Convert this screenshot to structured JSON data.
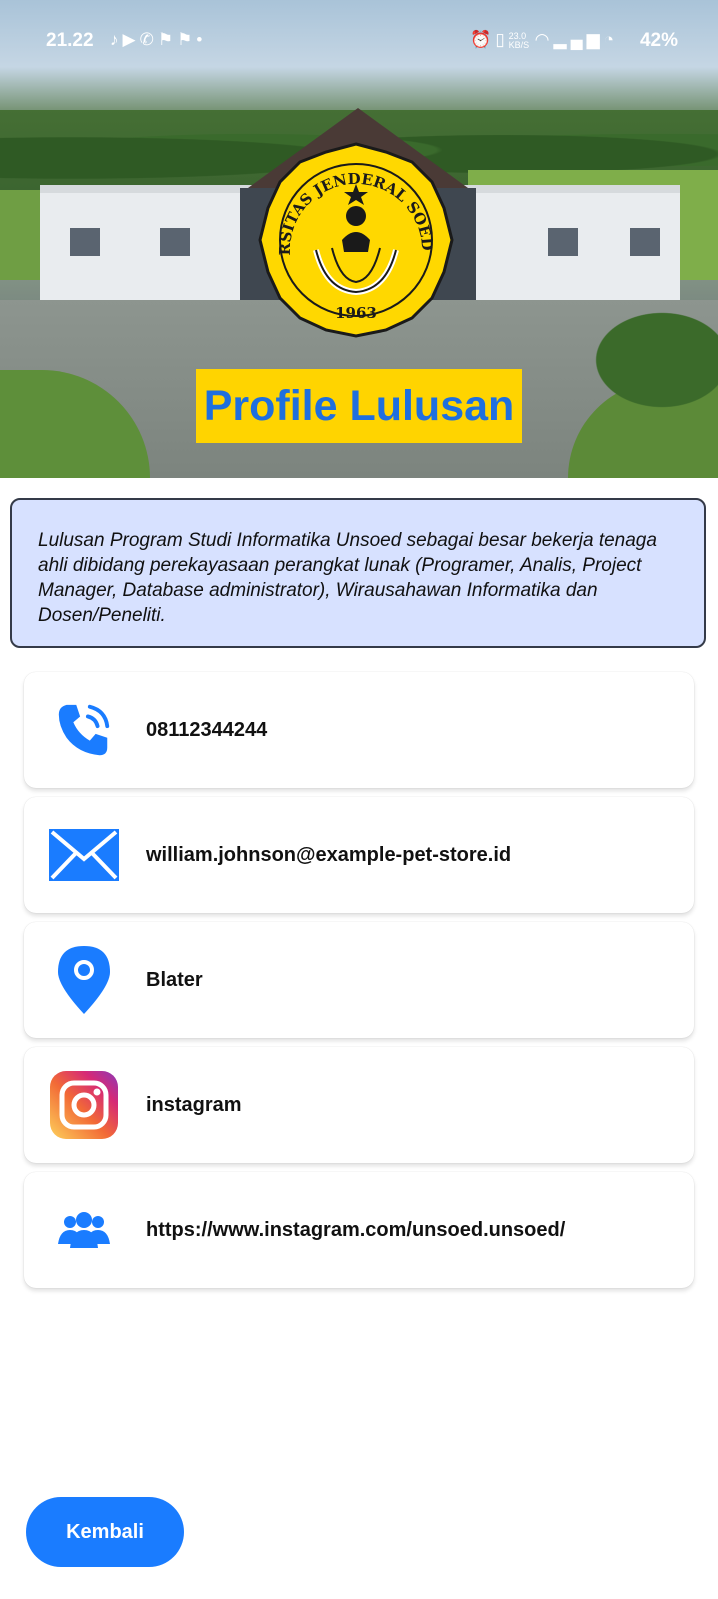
{
  "status_bar": {
    "time": "21.22",
    "network_speed": "23.0 KB/S",
    "battery": "42%",
    "icons": [
      "tiktok-icon",
      "youtube-icon",
      "phone-call-icon",
      "pinterest-icon",
      "pinterest-icon",
      "dot-icon",
      "alarm-icon",
      "vibrate-icon",
      "wifi-icon",
      "signal-icon",
      "battery-charging-icon"
    ]
  },
  "hero": {
    "emblem_text": "UNIVERSITAS JENDERAL SOEDIRMAN",
    "emblem_year": "1963",
    "title": "Profile Lulusan"
  },
  "description": "Lulusan Program Studi Informatika Unsoed sebagai besar bekerja tenaga ahli dibidang perekayasaan perangkat lunak (Programer, Analis, Project Manager, Database administrator), Wirausahawan Informatika dan Dosen/Peneliti.",
  "contacts": [
    {
      "icon": "phone-icon",
      "value": "08112344244"
    },
    {
      "icon": "email-icon",
      "value": "william.johnson@example-pet-store.id"
    },
    {
      "icon": "location-pin-icon",
      "value": "Blater"
    },
    {
      "icon": "instagram-icon",
      "value": "instagram"
    },
    {
      "icon": "group-icon",
      "value": "https://www.instagram.com/unsoed.unsoed/"
    }
  ],
  "back_button": "Kembali",
  "colors": {
    "accent": "#1a7cff",
    "title_bg": "#ffd400",
    "title_text": "#1f6fde",
    "desc_bg": "#d7e1ff"
  }
}
